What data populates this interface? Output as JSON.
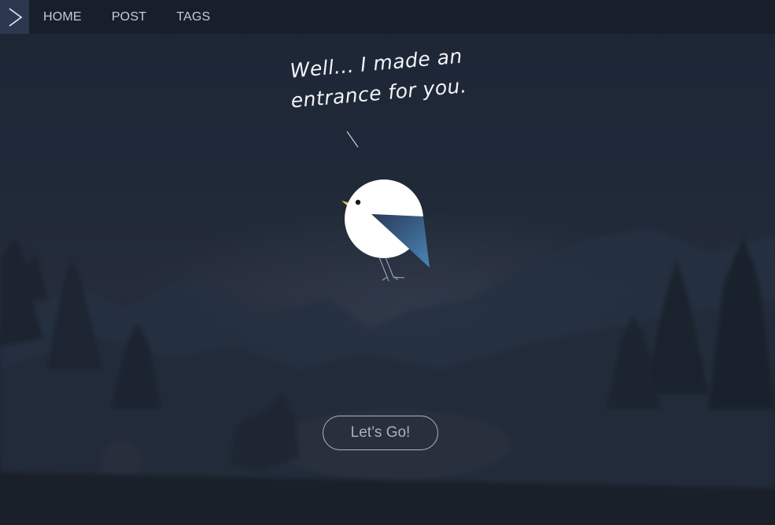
{
  "nav": {
    "items": [
      {
        "label": "HOME"
      },
      {
        "label": "POST"
      },
      {
        "label": "TAGS"
      }
    ]
  },
  "hero": {
    "speech_lines": [
      "Well... I made an",
      "entrance for you."
    ],
    "cta_label": "Let’s Go!"
  },
  "colors": {
    "background": "#1d2636",
    "nav_toggle": "#2c3850",
    "nav_text": "#c7ccd6",
    "bird_body": "#ffffff",
    "bird_wing": "#3f6e9e",
    "bird_beak": "#e6c35a",
    "button_border": "#aeb4c0"
  },
  "icons": {
    "nav_toggle": "chevron-right-icon"
  }
}
